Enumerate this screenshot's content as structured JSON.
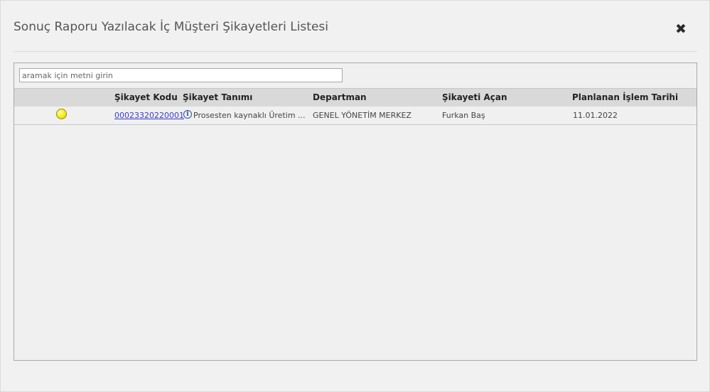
{
  "dialog": {
    "title": "Sonuç Raporu Yazılacak İç Müşteri Şikayetleri Listesi",
    "close_icon": "close-icon",
    "close_glyph": "✖"
  },
  "search": {
    "placeholder": "aramak için metni girin",
    "value": ""
  },
  "table": {
    "headers": {
      "code": "Şikayet Kodu",
      "description": "Şikayet Tanımı",
      "department": "Departman",
      "opener": "Şikayeti Açan",
      "planned_date": "Planlanan İşlem Tarihi"
    },
    "rows": [
      {
        "status_icon": "yellow-status-icon",
        "status_color": "#f4ea1a",
        "code": "00023320220001",
        "info_icon": "info-icon",
        "info_glyph": "i",
        "description": "Prosesten kaynaklı Üretim ...",
        "department": "GENEL YÖNETİM MERKEZ",
        "opener": "Furkan Baş",
        "planned_date": "11.01.2022"
      }
    ]
  },
  "colors": {
    "background": "#f1f1f1",
    "header_bg": "#d9d9d9",
    "link": "#3a3ad0"
  }
}
